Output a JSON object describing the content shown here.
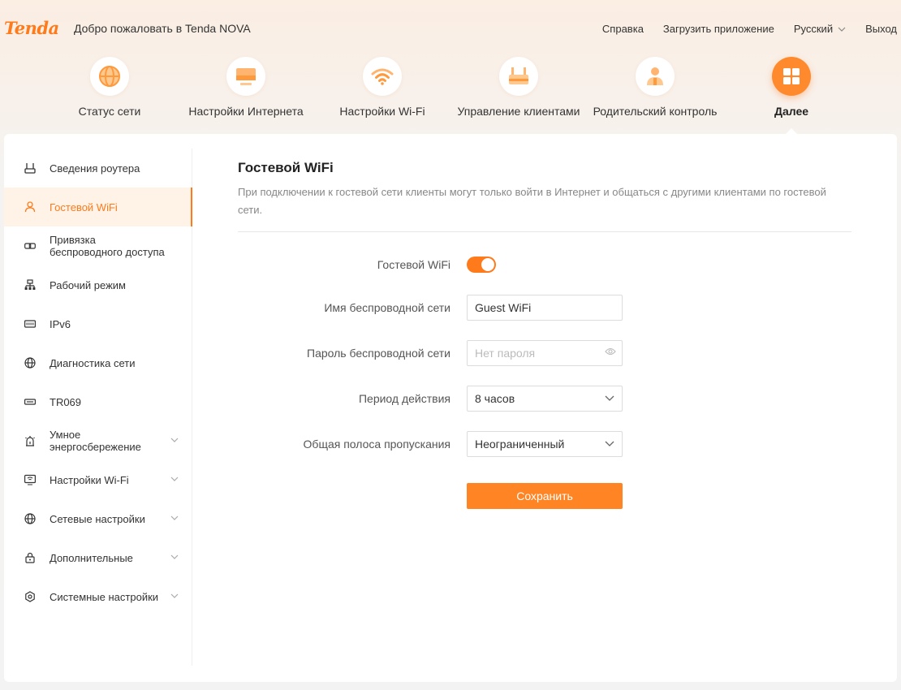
{
  "brand": {
    "logo": "Tenda",
    "accent": "#ff7a1a",
    "welcome": "Добро пожаловать в Tenda NOVA"
  },
  "top_links": {
    "help": "Справка",
    "download_app": "Загрузить приложение",
    "language": "Русский",
    "logout": "Выход"
  },
  "nav": [
    {
      "label": "Статус сети",
      "icon": "globe-icon"
    },
    {
      "label": "Настройки Интернета",
      "icon": "monitor-icon"
    },
    {
      "label": "Настройки Wi-Fi",
      "icon": "wifi-icon"
    },
    {
      "label": "Управление клиентами",
      "icon": "router-icon"
    },
    {
      "label": "Родительский контроль",
      "icon": "parent-icon"
    },
    {
      "label": "Далее",
      "icon": "grid-icon",
      "active": true
    }
  ],
  "sidebar": [
    {
      "label": "Сведения роутера",
      "icon": "router-icon"
    },
    {
      "label": "Гостевой WiFi",
      "icon": "guest-icon",
      "active": true
    },
    {
      "label": "Привязка беспроводного доступа",
      "icon": "link-icon"
    },
    {
      "label": "Рабочий режим",
      "icon": "sitemap-icon"
    },
    {
      "label": "IPv6",
      "icon": "ipv6-icon"
    },
    {
      "label": "Диагностика сети",
      "icon": "globe-icon"
    },
    {
      "label": "TR069",
      "icon": "tr069-icon"
    },
    {
      "label": "Умное энергосбережение",
      "icon": "alarm-icon",
      "expandable": true
    },
    {
      "label": "Настройки Wi-Fi",
      "icon": "wifi-settings-icon",
      "expandable": true
    },
    {
      "label": "Сетевые настройки",
      "icon": "globe-icon",
      "expandable": true
    },
    {
      "label": "Дополнительные",
      "icon": "lock-icon",
      "expandable": true
    },
    {
      "label": "Системные настройки",
      "icon": "gear-icon",
      "expandable": true
    }
  ],
  "page": {
    "title": "Гостевой WiFi",
    "description": "При подключении к гостевой сети клиенты могут только войти в Интернет и общаться с другими клиентами по гостевой сети."
  },
  "form": {
    "guest_wifi_label": "Гостевой WiFi",
    "guest_wifi_enabled": true,
    "ssid_label": "Имя беспроводной сети",
    "ssid_value": "Guest WiFi",
    "password_label": "Пароль беспроводной сети",
    "password_placeholder": "Нет пароля",
    "period_label": "Период действия",
    "period_value": "8 часов",
    "bandwidth_label": "Общая полоса пропускания",
    "bandwidth_value": "Неограниченный",
    "save_label": "Сохранить"
  }
}
